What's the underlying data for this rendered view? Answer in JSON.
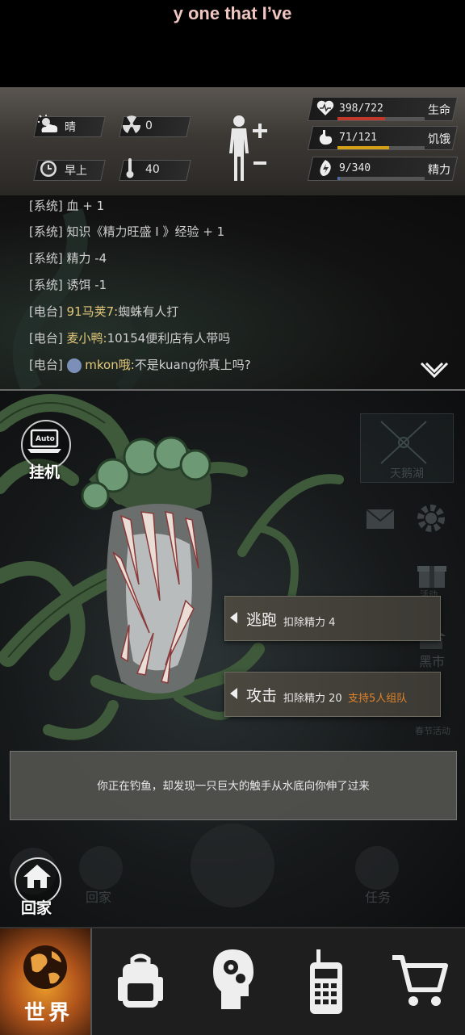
{
  "caption": {
    "text": "y one that I’ve"
  },
  "status": {
    "weather": {
      "icon": "sun-cloud-icon",
      "label": "晴"
    },
    "radiation": {
      "icon": "radiation-icon",
      "value": "0"
    },
    "time": {
      "icon": "clock-icon",
      "label": "早上"
    },
    "temperature": {
      "icon": "thermometer-icon",
      "value": "40"
    },
    "stats": [
      {
        "icon": "heart-icon",
        "text": "398/722",
        "name": "生命",
        "fraction": 0.55,
        "color": "#c0392b"
      },
      {
        "icon": "stomach-icon",
        "text": "71/121",
        "name": "饥饿",
        "fraction": 0.59,
        "color": "#d4a017"
      },
      {
        "icon": "energy-icon",
        "text": "9/340",
        "name": "精力",
        "fraction": 0.03,
        "color": "#4a6fb0"
      }
    ]
  },
  "chat": {
    "lines": [
      {
        "channel": "[系统]",
        "speaker": "",
        "text": "血 + 1"
      },
      {
        "channel": "[系统]",
        "speaker": "",
        "text": "知识《精力旺盛 I 》经验 + 1"
      },
      {
        "channel": "[系统]",
        "speaker": "",
        "text": "精力 -4"
      },
      {
        "channel": "[系统]",
        "speaker": "",
        "text": "诱饵 -1"
      },
      {
        "channel": "[电台]",
        "speaker": "91马荚7:",
        "text": "蜘蛛有人打"
      },
      {
        "channel": "[电台]",
        "speaker": "麦小鸭:",
        "text": "10154便利店有人带吗"
      },
      {
        "channel": "[电台]",
        "speaker": "mkon哦:",
        "text": "不是kuang你真上吗?"
      }
    ]
  },
  "scene": {
    "auto": {
      "badge": "Auto",
      "label": "挂机"
    },
    "location": "天鹅湖",
    "side_labels": {
      "gift": "活动",
      "black_market": "黑市",
      "festival": "春节活动"
    },
    "actions": [
      {
        "label": "逃跑",
        "cost": "扣除精力 4",
        "extra": ""
      },
      {
        "label": "攻击",
        "cost": "扣除精力 20",
        "extra": "支持5人组队",
        "extra_color": "#e0822a"
      }
    ],
    "event_text": "你正在钓鱼，却发现一只巨大的触手从水底向你伸了过来",
    "home": {
      "label": "回家"
    },
    "bg_home": "回家",
    "bg_task": "任务"
  },
  "nav": {
    "world_label": "世界",
    "items": [
      "world-globe-icon",
      "backpack-icon",
      "head-gears-icon",
      "radio-icon",
      "shopping-cart-icon"
    ]
  }
}
